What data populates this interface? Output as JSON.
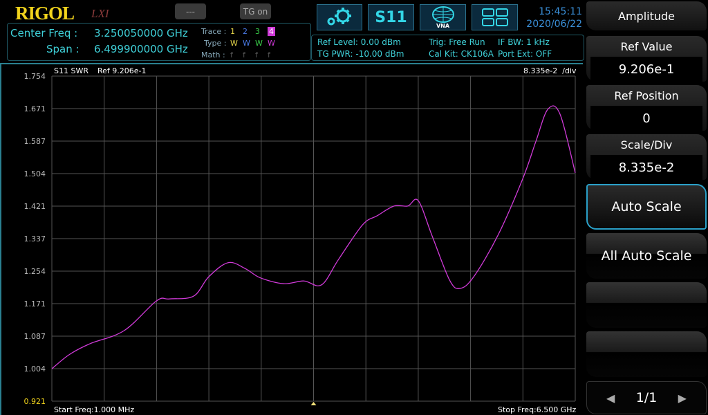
{
  "header": {
    "brand": "RIGOL",
    "lxi": "LXI",
    "btn1": "---",
    "btn2": "TG on",
    "center_label": "Center Freq :",
    "center_value": "3.250050000 GHz",
    "span_label": "Span :",
    "span_value": "6.499900000 GHz",
    "trace_label": "Trace :",
    "type_label": "Type :",
    "math_label": "Math :",
    "traces": [
      {
        "n": "1",
        "type": "W",
        "math": "f",
        "color": "#e6d64a"
      },
      {
        "n": "2",
        "type": "W",
        "math": "f",
        "color": "#4a7ae6"
      },
      {
        "n": "3",
        "type": "W",
        "math": "f",
        "color": "#3ad04a"
      },
      {
        "n": "4",
        "type": "W",
        "math": "f",
        "color": "#d03ad8"
      }
    ],
    "icons": [
      "settings-gear-icon",
      "s11-button",
      "vna-icon",
      "layout-grid-icon"
    ],
    "s11": "S11",
    "vna": "VNA",
    "time": "15:45:11",
    "date": "2020/06/22",
    "ref_level": "Ref Level: 0.00 dBm",
    "tg_pwr": "TG PWR: -10.00 dBm",
    "trig": "Trig: Free Run",
    "cal_kit": "Cal Kit: CK106A",
    "if_bw": "IF BW: 1 kHz",
    "port_ext": "Port Ext: OFF"
  },
  "plot": {
    "title": "S11  SWR",
    "ref": "Ref 9.206e-1",
    "scale": "8.335e-2  /div",
    "start": "Start Freq:1.000 MHz",
    "stop": "Stop Freq:6.500 GHz"
  },
  "chart_data": {
    "type": "line",
    "ylabel": "",
    "xlabel": "",
    "xlim": [
      0.001,
      6.5
    ],
    "ylim": [
      0.921,
      1.754
    ],
    "grid": true,
    "yticks": [
      "1.754",
      "1.671",
      "1.587",
      "1.504",
      "1.421",
      "1.337",
      "1.254",
      "1.171",
      "1.087",
      "1.004",
      "0.921"
    ],
    "trace_color": "#d03ad8",
    "x": [
      0.001,
      0.215,
      0.472,
      0.9,
      1.3,
      1.46,
      1.76,
      1.95,
      2.19,
      2.4,
      2.59,
      2.88,
      3.13,
      3.35,
      3.56,
      3.86,
      4.04,
      4.25,
      4.42,
      4.55,
      4.72,
      4.94,
      5.07,
      5.24,
      5.54,
      5.85,
      6.01,
      6.16,
      6.31,
      6.5
    ],
    "y": [
      1.004,
      1.04,
      1.068,
      1.102,
      1.178,
      1.183,
      1.19,
      1.24,
      1.276,
      1.261,
      1.237,
      1.222,
      1.229,
      1.219,
      1.284,
      1.373,
      1.396,
      1.421,
      1.421,
      1.435,
      1.346,
      1.231,
      1.21,
      1.24,
      1.346,
      1.492,
      1.586,
      1.669,
      1.657,
      1.506
    ]
  },
  "softkeys": {
    "title": "Amplitude",
    "ref_value_label": "Ref Value",
    "ref_value": "9.206e-1",
    "ref_pos_label": "Ref Position",
    "ref_pos": "0",
    "scale_label": "Scale/Div",
    "scale": "8.335e-2",
    "auto": "Auto Scale",
    "all_auto": "All Auto Scale",
    "page": "1/1"
  }
}
